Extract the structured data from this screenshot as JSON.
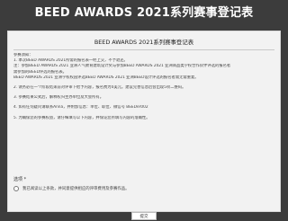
{
  "header": {
    "title": "BEED AWARDS 2021系列赛事登记表"
  },
  "form": {
    "title": "BEED AWARDS 2021系列赛事登记表",
    "intro": "参赛须知：",
    "lines": [
      "1. 本次BEED AWARDS 2021所需的报名表一经上交，不予退还。",
      "注：参加BEED AWARDS 2021 亚洲人气教育建筑设计奖与参加BEED AWARDS 2021 亚洲商品类学校合作伙伴评选的报名者",
      "需参加的BEED评选的报名表。",
      "BEED AWARDS 2021 亚洲学校校园评选BEED AWARDS 2021 亚洲BEED设计评选的报名者需无需重复。",
      "2. 请务必在一个阶段结束前对评审下给予内容，报名费为0美元。建议完善信息后会出现5项二维码。",
      "3. 参赛结果公式后，解释权归主办单位及大会所有。",
      "4. 如有任何疑问请联系Anna，并附加信息：单位、职位、微信号    BEEDer002",
      "5. 为确保您的参赛权益，请仔细填写以下内容，并保证您所填写内容的准确性。"
    ],
    "options_label": "选项 *",
    "agree_text": "我已阅读以上条款，并同意提供相应的评审费用及参赛作品。",
    "submit_label": "提交"
  }
}
